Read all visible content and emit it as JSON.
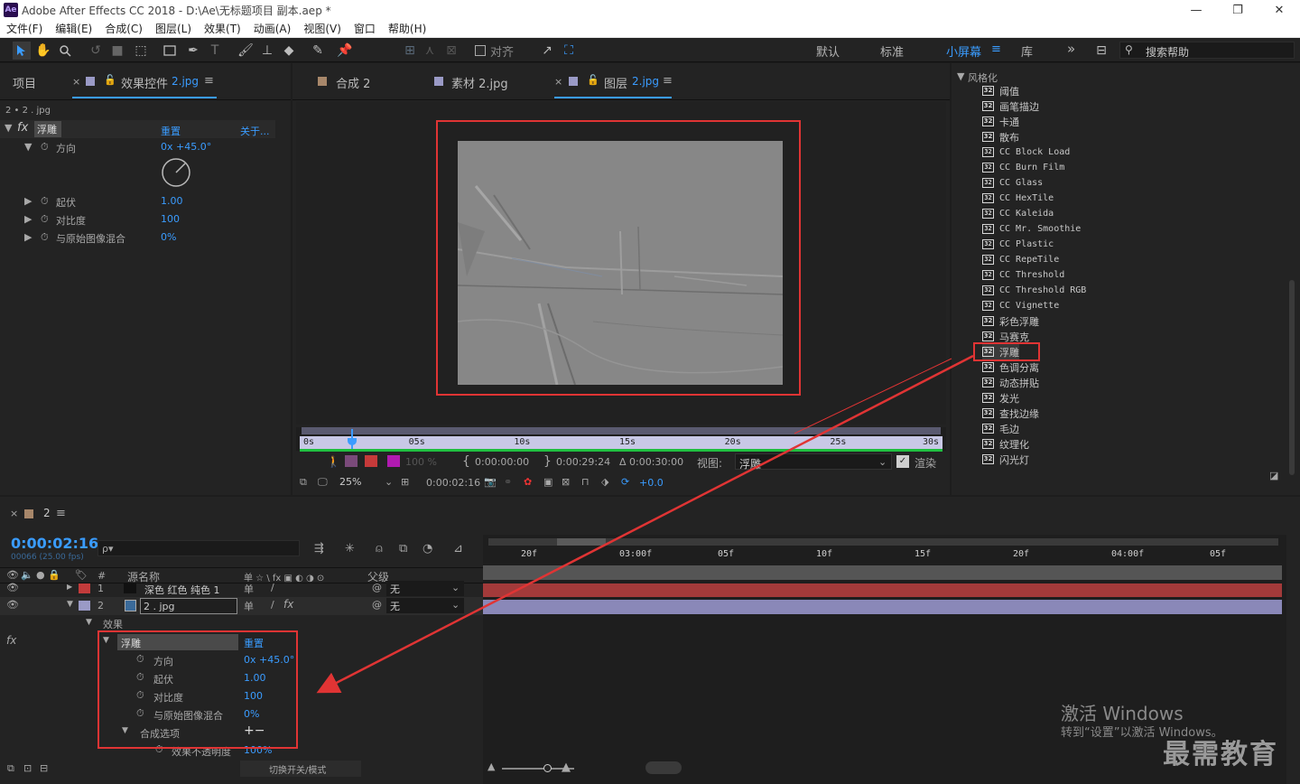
{
  "window": {
    "title": "Adobe After Effects CC 2018 - D:\\Ae\\无标题项目 副本.aep *",
    "logo": "Ae",
    "minimize": "—",
    "maximize": "❐",
    "close": "✕"
  },
  "menu": [
    "文件(F)",
    "编辑(E)",
    "合成(C)",
    "图层(L)",
    "效果(T)",
    "动画(A)",
    "视图(V)",
    "窗口",
    "帮助(H)"
  ],
  "toolbar": {
    "snap_label": "对齐",
    "workspaces": [
      "默认",
      "标准",
      "小屏幕",
      "库"
    ],
    "active_workspace": "小屏幕",
    "more": "»",
    "search_placeholder": "搜索帮助"
  },
  "effect_controls": {
    "tab_project": "项目",
    "tab_label": "效果控件",
    "tab_layer": "2.jpg",
    "source": "2 • 2 . jpg",
    "effect_name": "浮雕",
    "reset": "重置",
    "about": "关于...",
    "props": [
      {
        "name": "方向",
        "value": "0x +45.0°"
      },
      {
        "name": "起伏",
        "value": "1.00"
      },
      {
        "name": "对比度",
        "value": "100"
      },
      {
        "name": "与原始图像混合",
        "value": "0%"
      }
    ]
  },
  "viewer": {
    "tabs": [
      {
        "label": "合成 2",
        "color": "#a8876a"
      },
      {
        "label": "素材 2.jpg",
        "color": "#9a9ac6"
      },
      {
        "label": "图层",
        "sub": "2.jpg",
        "color": "#9a9ac6"
      }
    ],
    "ruler": [
      "0s",
      "05s",
      "10s",
      "15s",
      "20s",
      "25s",
      "30s"
    ],
    "playhead_fraction": 0.077,
    "controls": {
      "zoom_pct": "100 %",
      "in_time": "0:00:00:00",
      "out_time": "0:00:29:24",
      "duration": "Δ 0:00:30:00",
      "view_label": "视图:",
      "view_value": "浮雕",
      "render_label": "渲染",
      "magnification": "25%",
      "current_time": "0:00:02:16",
      "exposure": "+0.0"
    }
  },
  "effects_panel": {
    "category": "风格化",
    "items": [
      "阈值",
      "画笔描边",
      "卡通",
      "散布",
      "CC Block Load",
      "CC Burn Film",
      "CC Glass",
      "CC HexTile",
      "CC Kaleida",
      "CC Mr. Smoothie",
      "CC Plastic",
      "CC RepeTile",
      "CC Threshold",
      "CC Threshold RGB",
      "CC Vignette",
      "彩色浮雕",
      "马赛克",
      "浮雕",
      "色调分离",
      "动态拼贴",
      "发光",
      "查找边缘",
      "毛边",
      "纹理化",
      "闪光灯"
    ],
    "selected_item": "浮雕"
  },
  "timeline": {
    "comp_name": "2",
    "current_time": "0:00:02:16",
    "frame_info": "00066 (25.00 fps)",
    "search_placeholder": "ρ▾",
    "headers": {
      "num": "#",
      "source_name": "源名称",
      "switches": "单 ☆ \\ fx ▣ ◐ ◑ ⊙",
      "parent": "父级"
    },
    "layers": [
      {
        "num": "1",
        "name": "深色 红色 纯色 1",
        "color": "#c23b3b",
        "parent": "无"
      },
      {
        "num": "2",
        "name": "2 . jpg",
        "color": "#9a9ac6",
        "parent": "无"
      }
    ],
    "effects_group": "效果",
    "effect_name": "浮雕",
    "reset": "重置",
    "props": [
      {
        "name": "方向",
        "value": "0x +45.0°"
      },
      {
        "name": "起伏",
        "value": "1.00"
      },
      {
        "name": "对比度",
        "value": "100"
      },
      {
        "name": "与原始图像混合",
        "value": "0%"
      }
    ],
    "compositing_options": "合成选项",
    "plus_minus": "+−",
    "effect_opacity_label": "效果不透明度",
    "effect_opacity_value": "100%",
    "ruler": [
      "20f",
      "03:00f",
      "05f",
      "10f",
      "15f",
      "20f",
      "04:00f",
      "05f"
    ],
    "toggle_switches": "切换开关/模式"
  },
  "watermark": {
    "activate_title": "激活 Windows",
    "activate_sub": "转到“设置”以激活 Windows。",
    "brand": "最需教育"
  }
}
